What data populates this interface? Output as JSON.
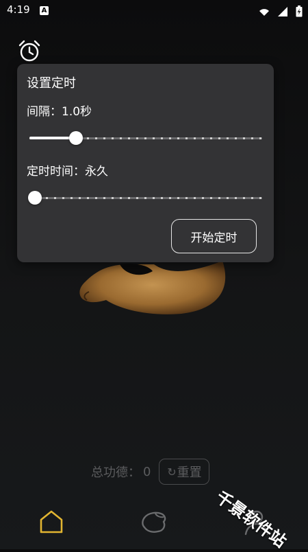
{
  "status_bar": {
    "time": "4:19",
    "notification_icon": "A"
  },
  "timer_dialog": {
    "title": "设置定时",
    "interval_label": "间隔：1.0秒",
    "interval_slider_fraction": 0.2,
    "duration_label": "定时时间：永久",
    "duration_slider_fraction": 0.0,
    "start_button": "开始定时"
  },
  "merit": {
    "label": "总功德：",
    "value": "0",
    "reset_icon": "↻",
    "reset_label": "重置"
  },
  "nav": {
    "items": [
      "home-icon",
      "fish-icon",
      "profile-icon"
    ],
    "active_color": "#e2b531",
    "inactive_color": "#6b6c6e"
  },
  "watermark": "千景软件站"
}
